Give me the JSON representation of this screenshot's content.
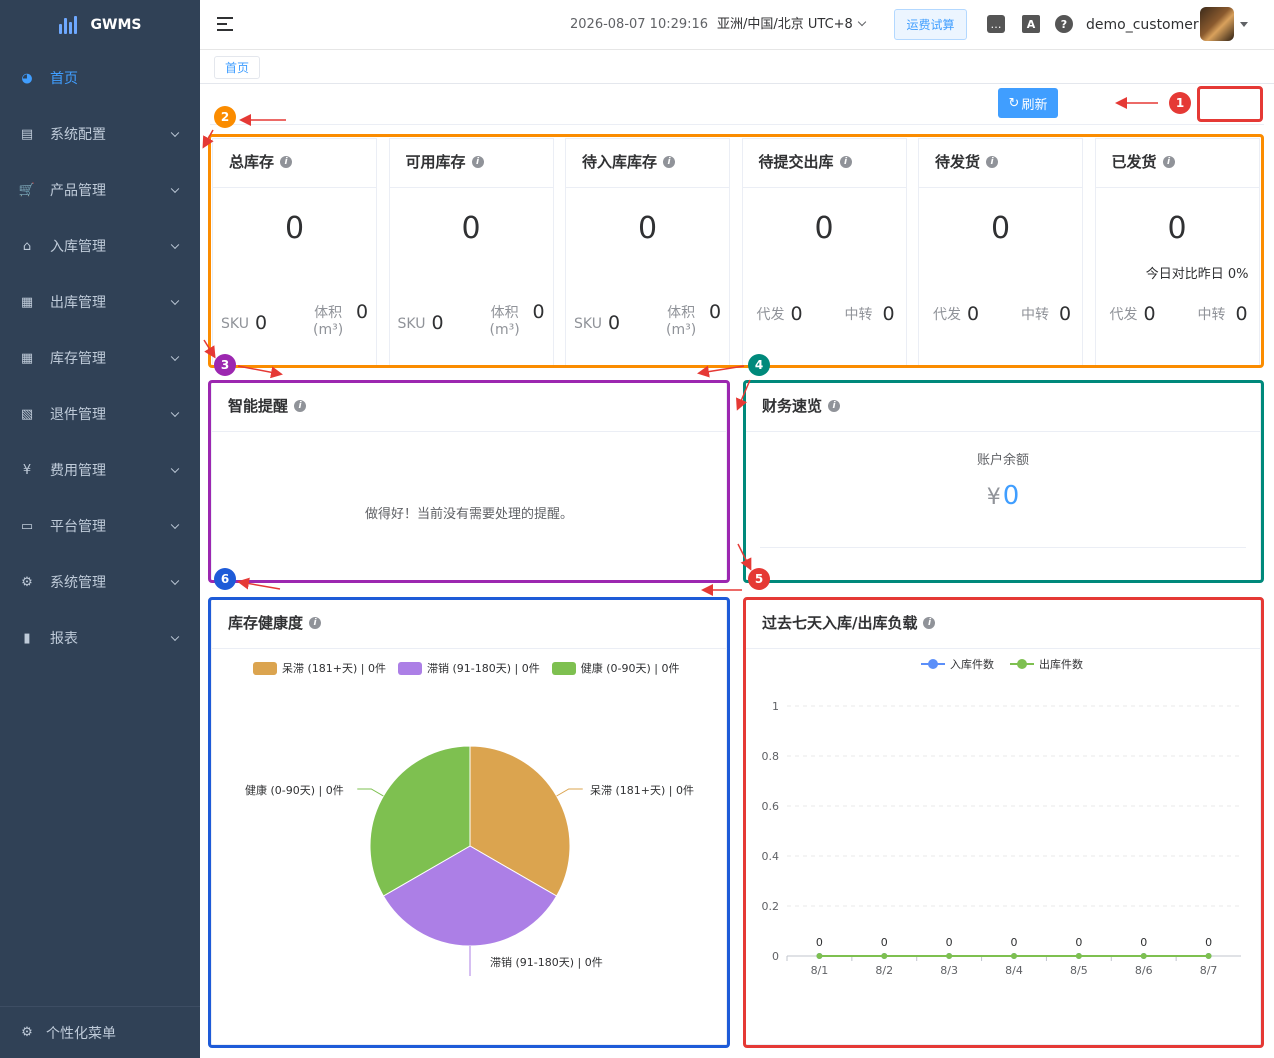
{
  "app": {
    "logo_text": "GWMS"
  },
  "sidebar": {
    "items": [
      {
        "label": "首页",
        "icon": "dashboard-icon",
        "active": true
      },
      {
        "label": "系统配置",
        "icon": "document-icon"
      },
      {
        "label": "产品管理",
        "icon": "cart-icon"
      },
      {
        "label": "入库管理",
        "icon": "home-icon"
      },
      {
        "label": "出库管理",
        "icon": "grid-icon"
      },
      {
        "label": "库存管理",
        "icon": "table-icon"
      },
      {
        "label": "退件管理",
        "icon": "return-doc-icon"
      },
      {
        "label": "费用管理",
        "icon": "yen-icon"
      },
      {
        "label": "平台管理",
        "icon": "shop-icon"
      },
      {
        "label": "系统管理",
        "icon": "gear-icon"
      },
      {
        "label": "报表",
        "icon": "bar-chart-icon"
      }
    ],
    "personalize": "个性化菜单"
  },
  "topbar": {
    "datetime": "2026-08-07 10:29:16",
    "timezone": "亚洲/中国/北京 UTC+8",
    "freight_button": "运费试算",
    "username": "demo_customer",
    "translate_glyph": "A",
    "help_glyph": "?"
  },
  "tags": {
    "home": "首页"
  },
  "refresh_label": "刷新",
  "annotations": {
    "colors": {
      "1": "#e53935",
      "2": "#fb8c00",
      "3": "#9c27b0",
      "4": "#00897b",
      "5": "#e53935",
      "6": "#1e5bd8"
    },
    "labels": [
      "1",
      "2",
      "3",
      "4",
      "5",
      "6"
    ]
  },
  "stats": [
    {
      "title": "总库存",
      "value": "0",
      "left_label": "SKU",
      "left_value": "0",
      "right_label": "体积",
      "right_unit": "(m³)",
      "right_value": "0"
    },
    {
      "title": "可用库存",
      "value": "0",
      "left_label": "SKU",
      "left_value": "0",
      "right_label": "体积",
      "right_unit": "(m³)",
      "right_value": "0"
    },
    {
      "title": "待入库库存",
      "value": "0",
      "left_label": "SKU",
      "left_value": "0",
      "right_label": "体积",
      "right_unit": "(m³)",
      "right_value": "0"
    },
    {
      "title": "待提交出库",
      "value": "0",
      "left_label": "代发",
      "left_value": "0",
      "right_label": "中转",
      "right_value": "0"
    },
    {
      "title": "待发货",
      "value": "0",
      "left_label": "代发",
      "left_value": "0",
      "right_label": "中转",
      "right_value": "0"
    },
    {
      "title": "已发货",
      "value": "0",
      "compare": "今日对比昨日 0%",
      "left_label": "代发",
      "left_value": "0",
      "right_label": "中转",
      "right_value": "0"
    }
  ],
  "reminder": {
    "title": "智能提醒",
    "empty": "做得好！当前没有需要处理的提醒。"
  },
  "finance": {
    "title": "财务速览",
    "balance_label": "账户余额",
    "currency": "¥",
    "balance": "0"
  },
  "health": {
    "title": "库存健康度",
    "legend": [
      "呆滞 (181+天) | 0件",
      "滞销 (91-180天) | 0件",
      "健康 (0-90天) | 0件"
    ],
    "colors": [
      "#dba44f",
      "#ac7fe6",
      "#7ec050"
    ]
  },
  "load": {
    "title": "过去七天入库/出库负载"
  },
  "chart_data": [
    {
      "type": "pie",
      "labels": [
        "呆滞 (181+天) | 0件",
        "滞销 (91-180天) | 0件",
        "健康 (0-90天) | 0件"
      ],
      "values": [
        0,
        0,
        0
      ],
      "colors": [
        "#dba44f",
        "#ac7fe6",
        "#7ec050"
      ]
    },
    {
      "type": "line",
      "categories": [
        "8/1",
        "8/2",
        "8/3",
        "8/4",
        "8/5",
        "8/6",
        "8/7"
      ],
      "series": [
        {
          "name": "入库件数",
          "values": [
            0,
            0,
            0,
            0,
            0,
            0,
            0
          ],
          "color": "#5b8ff9"
        },
        {
          "name": "出库件数",
          "values": [
            0,
            0,
            0,
            0,
            0,
            0,
            0
          ],
          "color": "#7ec050"
        }
      ],
      "ylim": [
        0,
        1
      ],
      "yticks": [
        "0",
        "0.2",
        "0.4",
        "0.6",
        "0.8",
        "1"
      ]
    }
  ]
}
